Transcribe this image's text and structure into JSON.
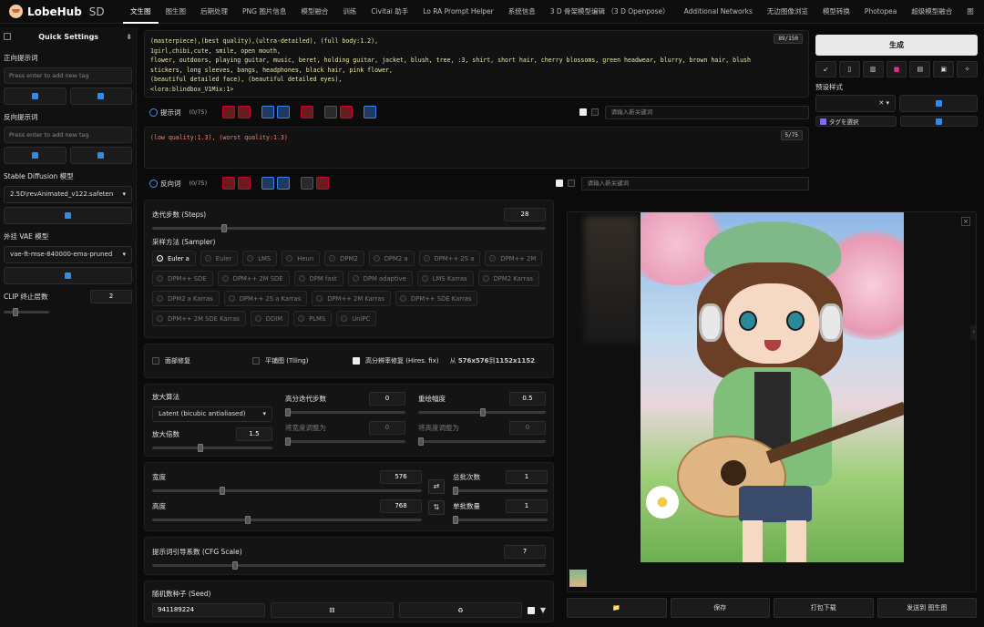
{
  "app": {
    "name": "LobeHub",
    "suffix": "SD"
  },
  "tabs": [
    "文生图",
    "图生图",
    "后期处理",
    "PNG 图片信息",
    "模型融合",
    "训练",
    "Civitai 助手",
    "Lo RA Prompt Helper",
    "系统信息",
    "3 D 骨架模型编辑 （3 D Openpose）",
    "Additional Networks",
    "无边图像浏览",
    "模型转换",
    "Photopea",
    "超级模型融合",
    "图"
  ],
  "sidebar": {
    "title": "Quick Settings",
    "positive_label": "正向提示词",
    "positive_placeholder": "Press enter to add new tag",
    "negative_label": "反向提示词",
    "negative_placeholder": "Press enter to add new tag",
    "model_label": "Stable Diffusion 模型",
    "model_value": "2.5D\\revAnimated_v122.safeten",
    "vae_label": "外挂 VAE 模型",
    "vae_value": "vae-ft-mse-840000-ema-pruned",
    "clip_label": "CLIP 终止层数",
    "clip_value": "2"
  },
  "prompt": {
    "lines": [
      "(masterpiece),(best quality),(ultra-detailed), (full body:1.2),",
      "1girl,chibi,cute, smile, open mouth,",
      "flower, outdoors, playing guitar, music, beret, holding guitar, jacket, blush, tree, :3, shirt, short hair, cherry blossoms, green headwear, blurry, brown hair, blush",
      "stickers, long sleeves, bangs, headphones, black hair, pink flower,",
      "(beautiful detailed face), (beautiful detailed eyes),",
      " <lora:blindbox_V1Mix:1>"
    ],
    "counter": "89/150",
    "label": "提示词",
    "count": "(0/75)",
    "kw_placeholder": "请输入新关键词"
  },
  "negative": {
    "text": "(low quality:1.3), (worst quality:1.3)",
    "counter": "5/75",
    "label": "反向词",
    "count": "(0/75)",
    "kw_placeholder": "请输入新关键词"
  },
  "steps": {
    "label": "迭代步数 (Steps)",
    "value": "28"
  },
  "sampler": {
    "label": "采样方法 (Sampler)",
    "options": [
      "Euler a",
      "Euler",
      "LMS",
      "Heun",
      "DPM2",
      "DPM2 a",
      "DPM++ 2S a",
      "DPM++ 2M",
      "DPM++ SDE",
      "DPM++ 2M SDE",
      "DPM fast",
      "DPM adaptive",
      "LMS Karras",
      "DPM2 Karras",
      "DPM2 a Karras",
      "DPM++ 2S a Karras",
      "DPM++ 2M Karras",
      "DPM++ SDE Karras",
      "DPM++ 2M SDE Karras",
      "DDIM",
      "PLMS",
      "UniPC"
    ],
    "selected": "Euler a"
  },
  "options": {
    "face": "面部修复",
    "tiling": "平铺图 (Tiling)",
    "hires": "高分辨率修复 (Hires. fix)",
    "from": "从",
    "size_from": "576x576",
    "to": "到",
    "size_to": "1152x1152"
  },
  "hires": {
    "upscaler_label": "放大算法",
    "upscaler_value": "Latent (bicubic antialiased)",
    "hires_steps_label": "高分迭代步数",
    "hires_steps_value": "0",
    "denoise_label": "重绘幅度",
    "denoise_value": "0.5",
    "scale_label": "放大倍数",
    "scale_value": "1.5",
    "resize_w_label": "将宽度调整为",
    "resize_w_value": "0",
    "resize_h_label": "将高度调整为",
    "resize_h_value": "0"
  },
  "size": {
    "width_label": "宽度",
    "width_value": "576",
    "height_label": "高度",
    "height_value": "768",
    "batch_count_label": "总批次数",
    "batch_count_value": "1",
    "batch_size_label": "单批数量",
    "batch_size_value": "1"
  },
  "cfg": {
    "label": "提示词引导系数 (CFG Scale)",
    "value": "7"
  },
  "seed": {
    "label": "随机数种子 (Seed)",
    "value": "941189224"
  },
  "right": {
    "generate": "生成",
    "style_label": "预设样式",
    "tag_select": "タグを選択"
  },
  "actions": [
    "📁",
    "保存",
    "打包下载",
    "发送到 图生图"
  ]
}
